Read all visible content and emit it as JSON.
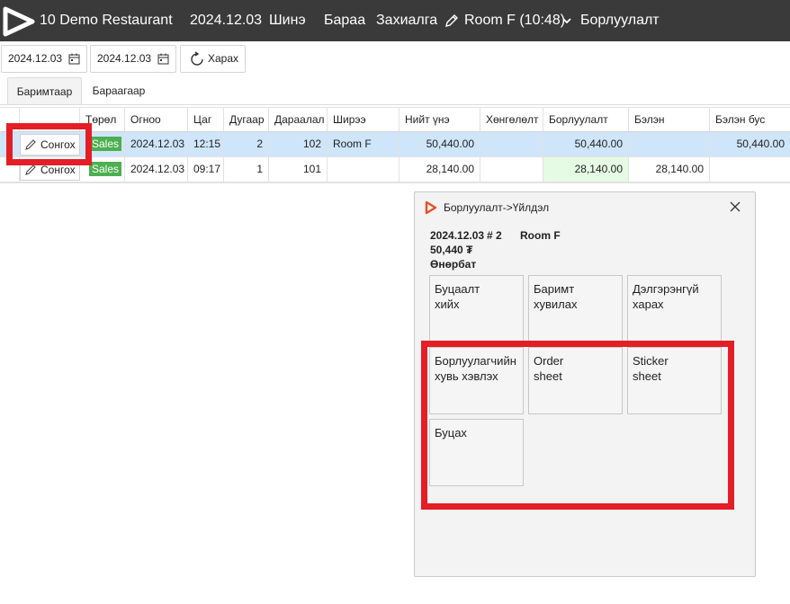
{
  "topbar": {
    "app_title": "10 Demo Restaurant",
    "date": "2024.12.03",
    "new": "Шинэ",
    "goods": "Бараа",
    "order": "Захиалга",
    "room": "Room F (10:48)",
    "sales": "Борлуулалт"
  },
  "toolbar": {
    "date_from": "2024.12.03",
    "date_to": "2024.12.03",
    "view_label": "Харах"
  },
  "tabs": [
    "Баримтаар",
    "Бараагаар"
  ],
  "grid": {
    "headers": [
      "Төрөл",
      "Огноо",
      "Цаг",
      "Дугаар",
      "Дараалал",
      "Ширээ",
      "Нийт үнэ",
      "Хөнгөлөлт",
      "Борлуулалт",
      "Бэлэн",
      "Бэлэн бус"
    ],
    "select_label": "Сонгох",
    "rows": [
      {
        "type": "Sales",
        "date": "2024.12.03",
        "time": "12:15",
        "number": "2",
        "sequence": "102",
        "table": "Room F",
        "total": "50,440.00",
        "discount": "",
        "sales": "50,440.00",
        "cash": "",
        "noncash": "50,440.00"
      },
      {
        "type": "Sales",
        "date": "2024.12.03",
        "time": "09:17",
        "number": "1",
        "sequence": "101",
        "table": "",
        "total": "28,140.00",
        "discount": "",
        "sales": "28,140.00",
        "cash": "28,140.00",
        "noncash": ""
      }
    ]
  },
  "dialog": {
    "title": "Борлуулалт->Үйлдэл",
    "date": "2024.12.03",
    "number": "# 2",
    "room": "Room F",
    "amount": "50,440 ₮",
    "user": "Өнөрбат",
    "buttons": [
      "Буцаалт\nхийх",
      "Баримт\nхувилах",
      "Дэлгэрэнгүй\nхарах",
      "Борлуулагчийн\nхувь хэвлэх",
      "Order\nsheet",
      "Sticker\nsheet",
      "Буцах"
    ]
  },
  "colors": {
    "topbar": "#3a3a3a",
    "selected_row": "#cfe5fa",
    "badge": "#4caf50",
    "highlight": "#e41e26",
    "sales_cell": "#e6fbe3"
  }
}
